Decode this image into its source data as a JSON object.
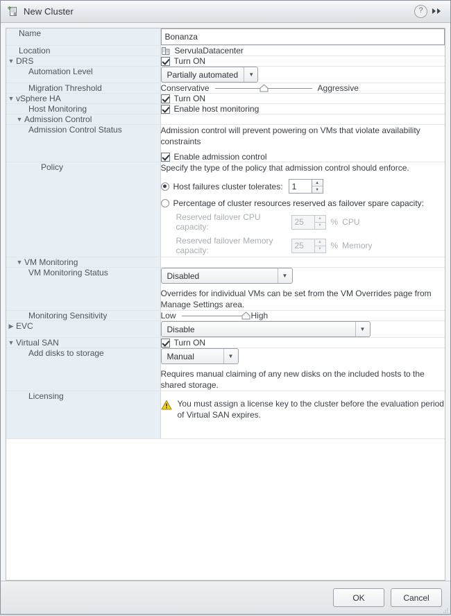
{
  "window": {
    "title": "New Cluster",
    "icon": "new-cluster-icon",
    "help_label": "?",
    "expand_label": "▶▶"
  },
  "form": {
    "name": {
      "label": "Name",
      "value": "Bonanza",
      "placeholder": ""
    },
    "location": {
      "label": "Location",
      "value": "ServulaDatacenter",
      "icon": "datacenter-icon"
    },
    "drs": {
      "label": "DRS",
      "expanded": true,
      "turn_on_label": "Turn ON",
      "turn_on_checked": true,
      "automation_level": {
        "label": "Automation Level",
        "value": "Partially automated"
      },
      "migration_threshold": {
        "label": "Migration Threshold",
        "low_label": "Conservative",
        "high_label": "Aggressive",
        "position_percent": 50
      }
    },
    "vsphere_ha": {
      "label": "vSphere HA",
      "expanded": true,
      "turn_on_label": "Turn ON",
      "turn_on_checked": true,
      "host_monitoring": {
        "label": "Host Monitoring",
        "checkbox_label": "Enable host monitoring",
        "checked": true
      },
      "admission_control": {
        "label": "Admission Control",
        "expanded": true,
        "status": {
          "label": "Admission Control Status",
          "description": "Admission control will prevent powering on VMs that violate availability constraints",
          "checkbox_label": "Enable admission control",
          "checked": true
        },
        "policy": {
          "label": "Policy",
          "description": "Specify the type of the policy that admission control should enforce.",
          "option_host_failures": {
            "label": "Host failures cluster tolerates:",
            "selected": true,
            "value": "1"
          },
          "option_percentage": {
            "label": "Percentage of cluster resources reserved as failover spare capacity:",
            "selected": false,
            "cpu": {
              "label": "Reserved failover CPU capacity:",
              "value": "25",
              "percent_sign": "%",
              "unit": "CPU"
            },
            "memory": {
              "label": "Reserved failover Memory capacity:",
              "value": "25",
              "percent_sign": "%",
              "unit": "Memory"
            }
          }
        }
      },
      "vm_monitoring": {
        "label": "VM Monitoring",
        "expanded": true,
        "status": {
          "label": "VM Monitoring Status",
          "value": "Disabled",
          "description": "Overrides for individual VMs can be set from the VM Overrides page from Manage Settings area."
        },
        "sensitivity": {
          "label": "Monitoring Sensitivity",
          "low_label": "Low",
          "high_label": "High",
          "position_percent": 100
        }
      }
    },
    "evc": {
      "label": "EVC",
      "expanded": false,
      "value": "Disable"
    },
    "virtual_san": {
      "label": "Virtual SAN",
      "expanded": true,
      "turn_on_label": "Turn ON",
      "turn_on_checked": true,
      "add_disks": {
        "label": "Add disks to storage",
        "value": "Manual",
        "description": "Requires manual claiming of any new disks on the included hosts to the shared storage."
      }
    },
    "licensing": {
      "label": "Licensing",
      "icon": "warning-icon",
      "message": "You must assign a license key to the cluster before the evaluation period of Virtual SAN expires."
    }
  },
  "footer": {
    "ok_label": "OK",
    "cancel_label": "Cancel"
  },
  "colors": {
    "label_column": "#e7eff4",
    "panel_background": "#ffffff",
    "window_chrome": "#e6e9ec",
    "warning": "#f5c518",
    "accent_border": "#b9bfc5"
  }
}
